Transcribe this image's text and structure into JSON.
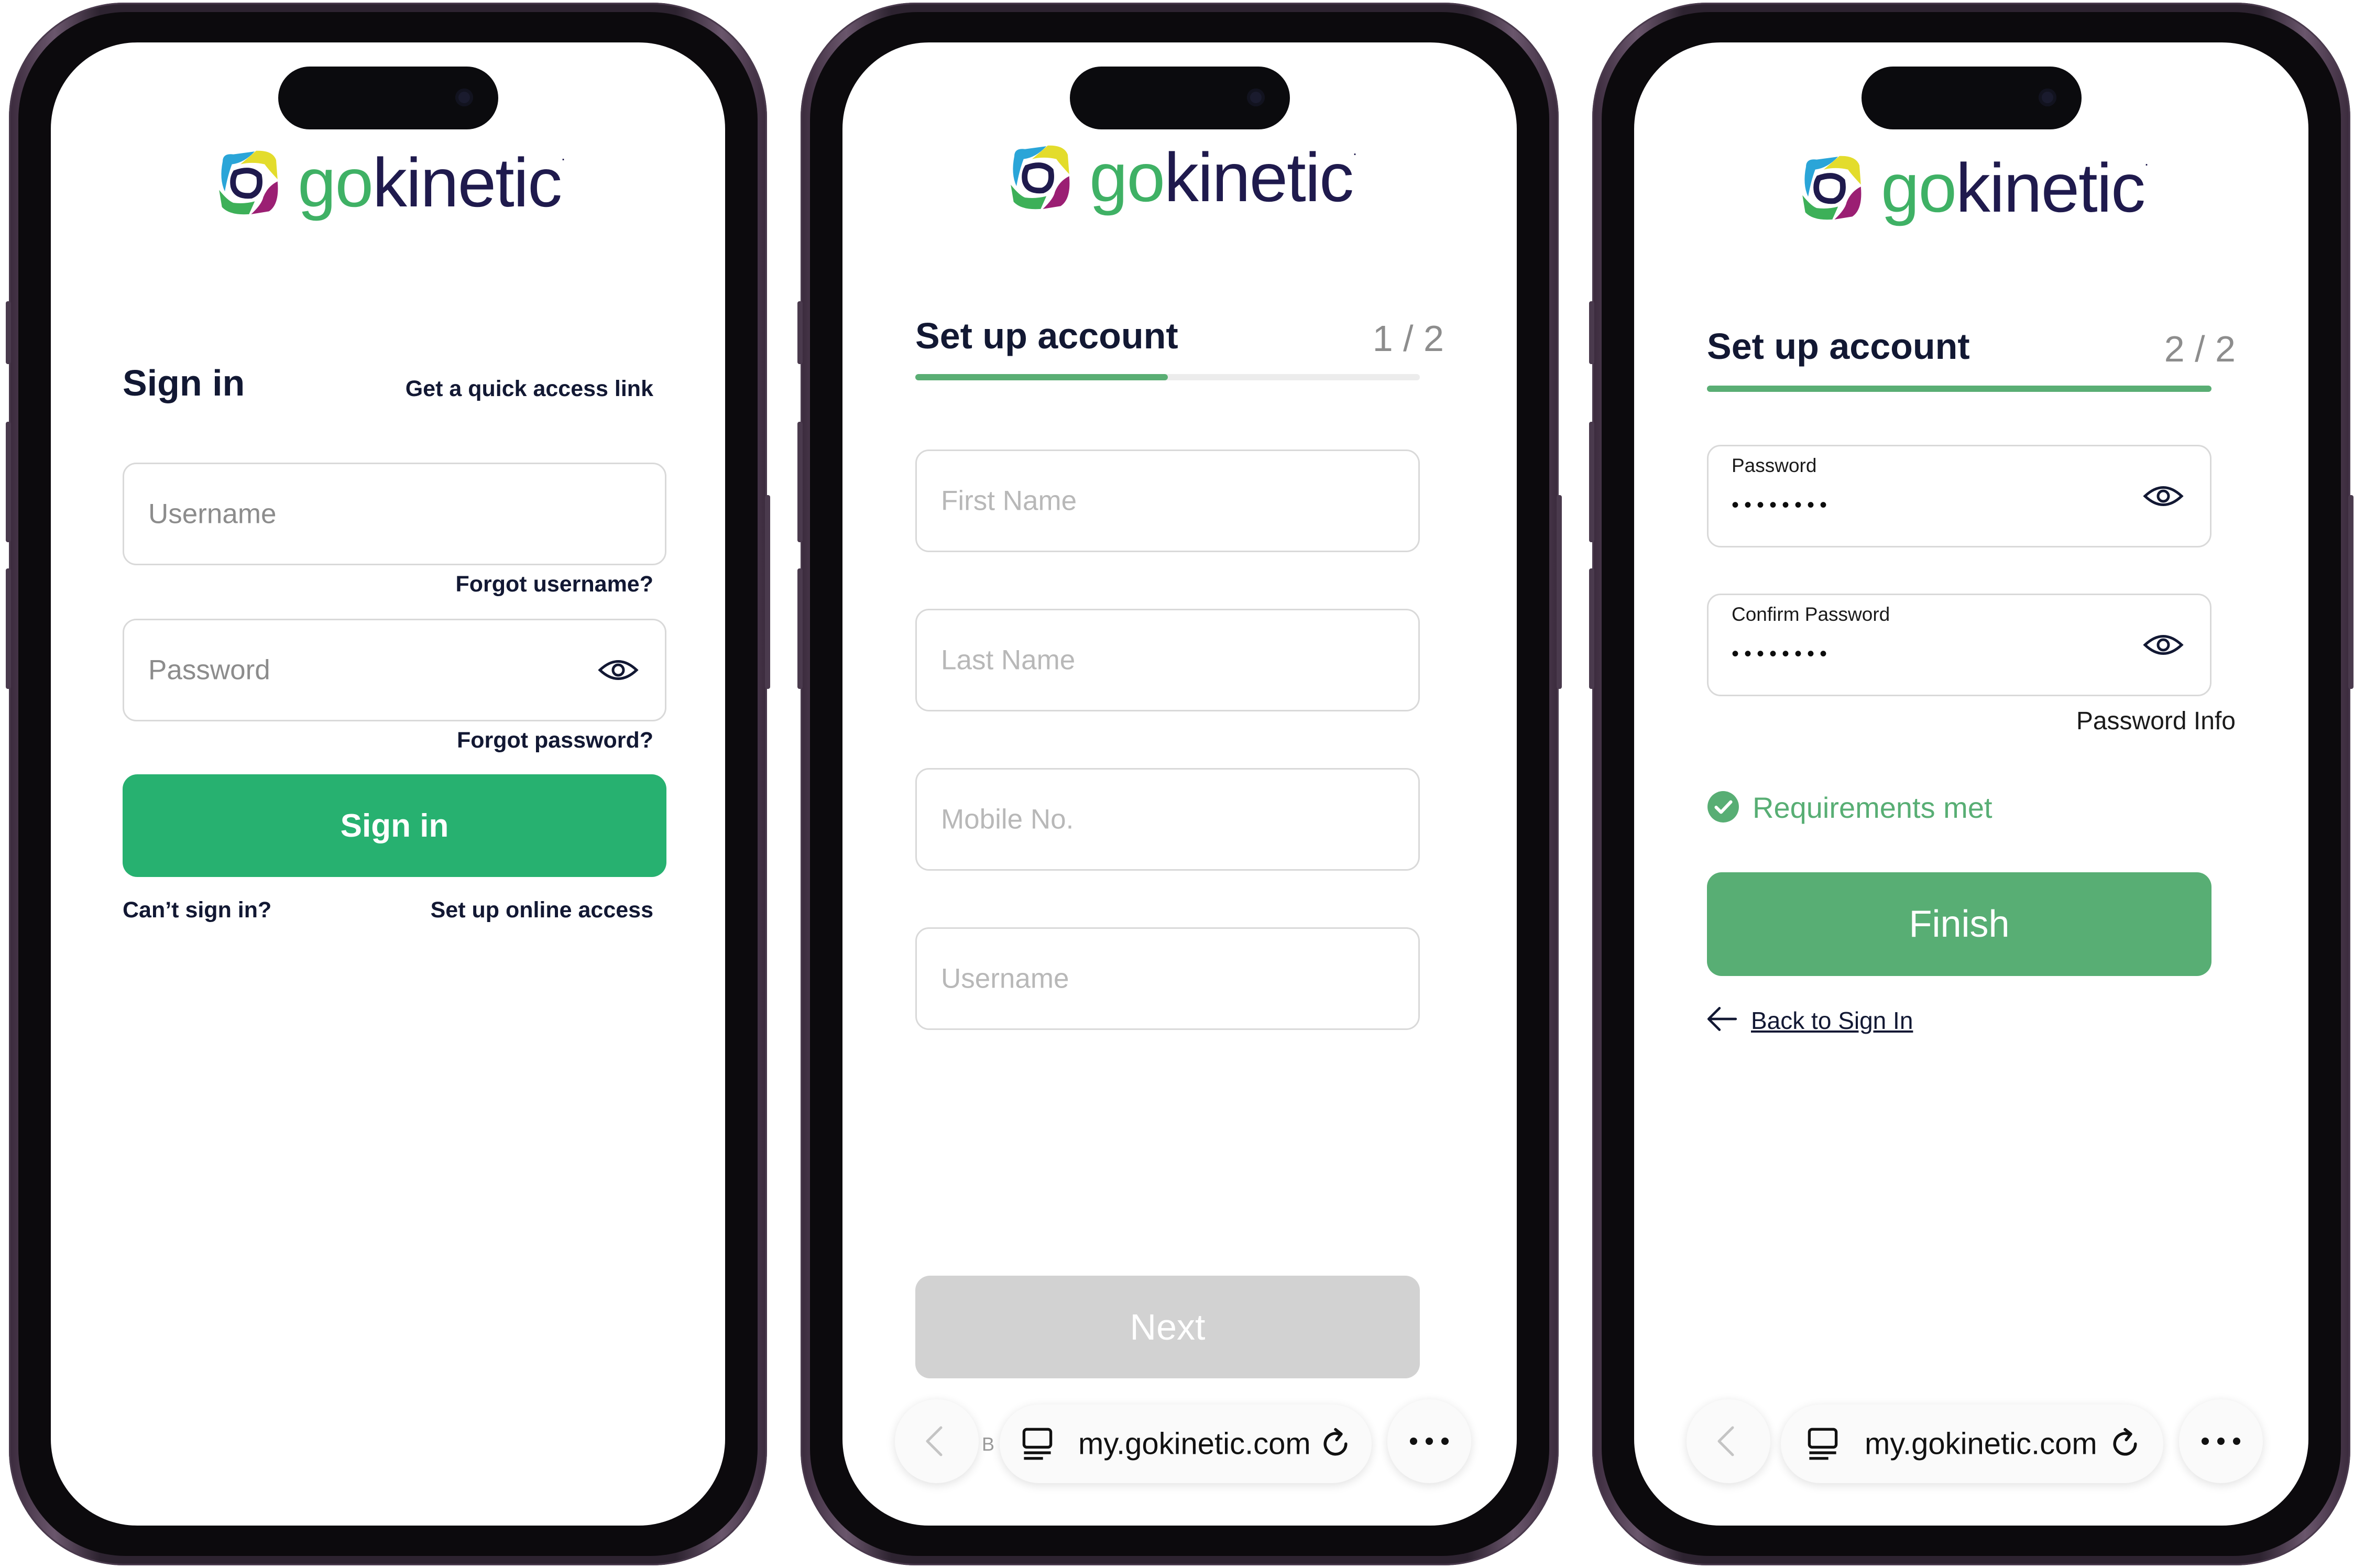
{
  "brand": {
    "name_prefix": "go",
    "name_suffix": "kinetic",
    "trademark_dot": "."
  },
  "screen1": {
    "title": "Sign in",
    "quick_link": "Get a quick access link",
    "username_placeholder": "Username",
    "forgot_username": "Forgot username?",
    "password_placeholder": "Password",
    "forgot_password": "Forgot password?",
    "signin_button": "Sign in",
    "cant_sign_in": "Can’t sign in?",
    "setup_online": "Set up online access",
    "colors": {
      "button": "#27b170"
    }
  },
  "screen2": {
    "title": "Set up account",
    "step": "1 / 2",
    "progress": 0.5,
    "fields": [
      "First Name",
      "Last Name",
      "Mobile No.",
      "Username"
    ],
    "next_button": "Next",
    "url": "my.gokinetic.com",
    "tab_letter": "B",
    "colors": {
      "button_disabled": "#d2d2d2"
    }
  },
  "screen3": {
    "title": "Set up account",
    "step": "2 / 2",
    "progress": 1.0,
    "password_label": "Password",
    "password_value": "••••••••",
    "confirm_label": "Confirm Password",
    "confirm_value": "••••••••",
    "password_info": "Password Info",
    "requirements": "Requirements met",
    "finish_button": "Finish",
    "back_link": "Back to Sign In",
    "url": "my.gokinetic.com",
    "colors": {
      "button": "#58ae74",
      "check": "#58ae74"
    }
  },
  "icons": [
    "eye-icon",
    "check-circle-icon",
    "back-arrow-icon",
    "tabs-icon",
    "reload-icon",
    "more-icon",
    "chevron-left-icon"
  ]
}
